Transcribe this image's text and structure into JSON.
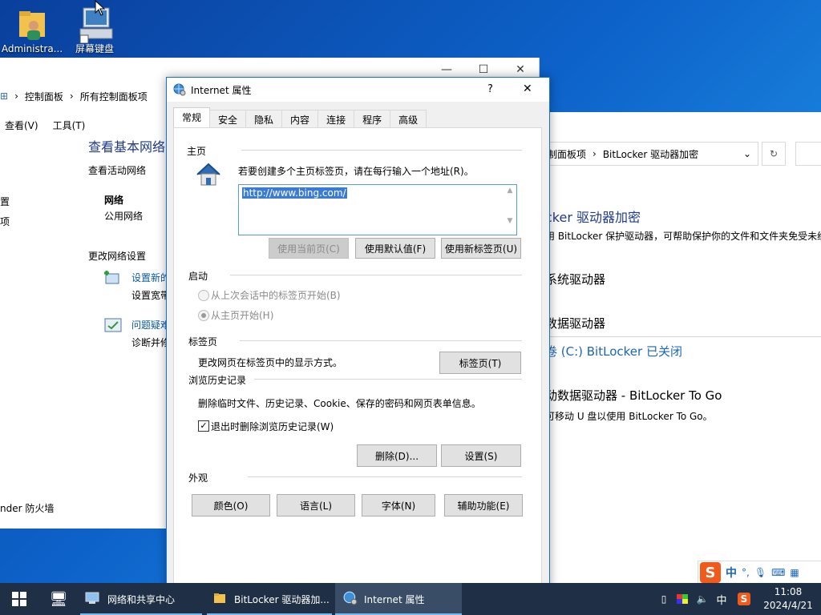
{
  "desktop": {
    "icons": [
      {
        "label": "Administra..."
      },
      {
        "label": "屏幕键盘"
      }
    ]
  },
  "bitlocker_window": {
    "breadcrumb": [
      "制面板项",
      "BitLocker 驱动器加密"
    ],
    "heading": "cker 驱动器加密",
    "description": "用 BitLocker 保护驱动器，可帮助保护你的文件和文件夹免受未经",
    "os_drive_heading": "系统驱动器",
    "data_drive_heading": "数据驱动器",
    "c_drive": "卷 (C:) BitLocker 已关闭",
    "removable_heading": "动数据驱动器 - BitLocker To Go",
    "removable_desc": "可移动 U 盘以使用 BitLocker To Go。"
  },
  "control_panel_window": {
    "breadcrumb": [
      "控制面板",
      "所有控制面板项"
    ],
    "menu": [
      "查看(V)",
      "工具(T)"
    ],
    "left_items": [
      "置",
      "项"
    ],
    "heading": "查看基本网络",
    "active_networks_label": "查看活动网络",
    "network_name": "网络",
    "network_type": "公用网络",
    "change_settings_label": "更改网络设置",
    "setting1_link": "设置新的",
    "setting1_desc": "设置宽带",
    "setting2_link": "问题疑难",
    "setting2_desc": "诊断并修",
    "firewall": "nder 防火墙"
  },
  "dialog": {
    "title": "Internet 属性",
    "help": "?",
    "close": "✕",
    "tabs": [
      "常规",
      "安全",
      "隐私",
      "内容",
      "连接",
      "程序",
      "高级"
    ],
    "homepage": {
      "section": "主页",
      "instruction": "若要创建多个主页标签页，请在每行输入一个地址(R)。",
      "url": "http://www.bing.com/",
      "use_current": "使用当前页(C)",
      "use_default": "使用默认值(F)",
      "use_new_tab": "使用新标签页(U)"
    },
    "startup": {
      "section": "启动",
      "option1": "从上次会话中的标签页开始(B)",
      "option2": "从主页开始(H)"
    },
    "tabs_section": {
      "section": "标签页",
      "desc": "更改网页在标签页中的显示方式。",
      "button": "标签页(T)"
    },
    "history": {
      "section": "浏览历史记录",
      "desc": "删除临时文件、历史记录、Cookie、保存的密码和网页表单信息。",
      "checkbox": "退出时删除浏览历史记录(W)",
      "checked": true,
      "delete": "删除(D)...",
      "settings": "设置(S)"
    },
    "appearance": {
      "section": "外观",
      "colors": "颜色(O)",
      "languages": "语言(L)",
      "fonts": "字体(N)",
      "accessibility": "辅助功能(E)"
    }
  },
  "ime_bar": {
    "mode": "中",
    "punct": "°,"
  },
  "taskbar": {
    "items": [
      {
        "label": "网络和共享中心"
      },
      {
        "label": "BitLocker 驱动器加..."
      },
      {
        "label": "Internet 属性"
      }
    ],
    "ime": "中",
    "time": "11:08",
    "date": "2024/4/21"
  },
  "colors": {
    "accent": "#1572d1",
    "link": "#0b5aa8",
    "taskbar": "#1f2f45"
  }
}
